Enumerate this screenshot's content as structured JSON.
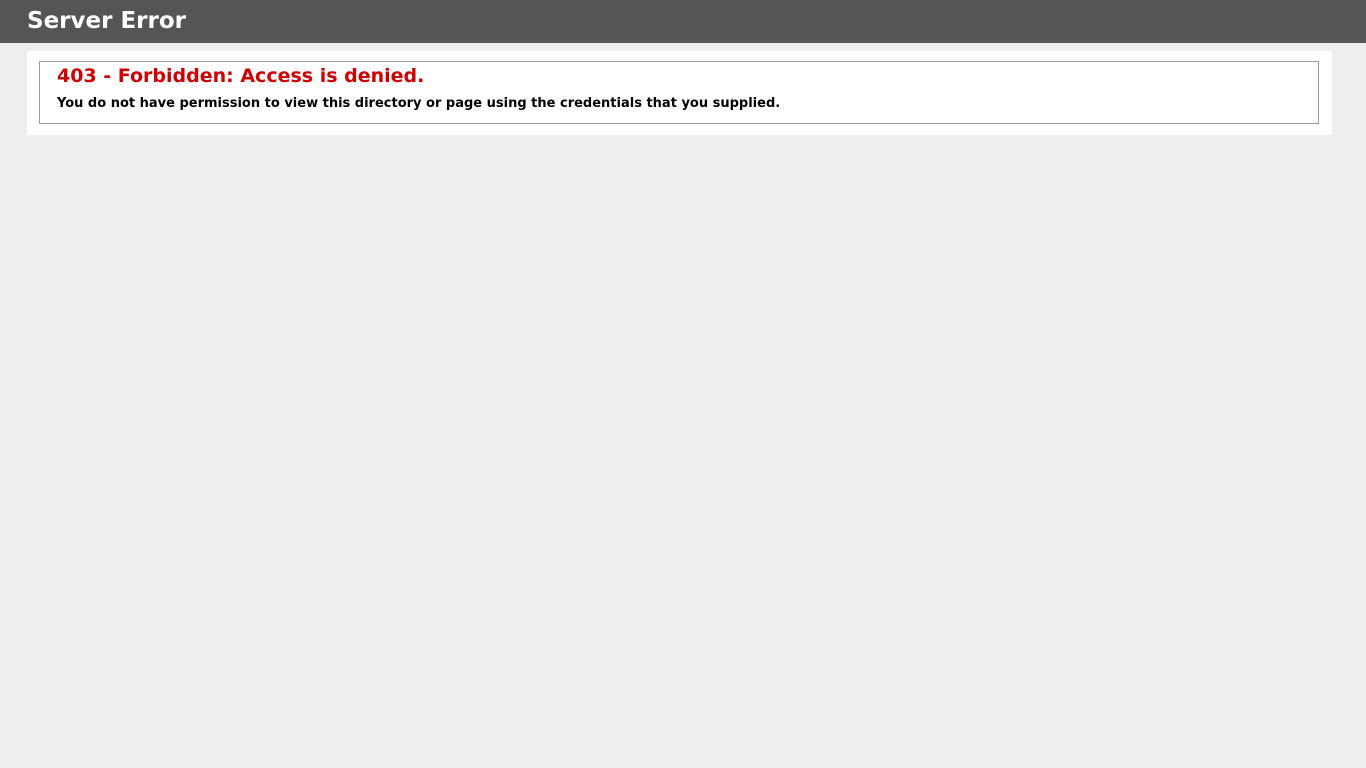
{
  "header": {
    "title": "Server Error"
  },
  "error": {
    "heading": "403 - Forbidden: Access is denied.",
    "message": "You do not have permission to view this directory or page using the credentials that you supplied."
  },
  "colors": {
    "header_background": "#555555",
    "page_background": "#eeeeee",
    "error_heading": "#cc0000"
  }
}
